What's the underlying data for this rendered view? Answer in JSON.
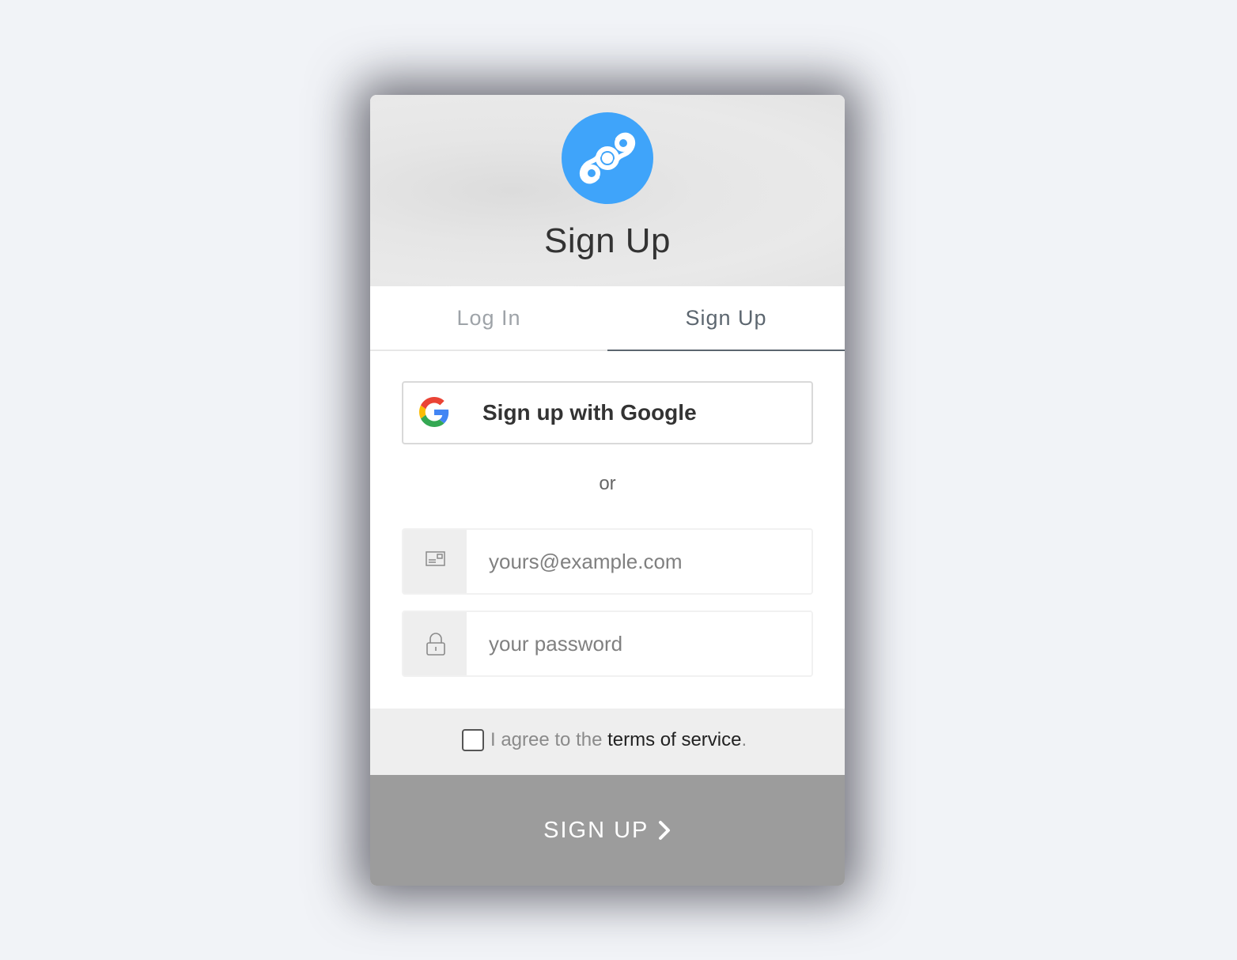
{
  "header": {
    "title": "Sign Up",
    "logo_icon": "helium-logo-icon",
    "logo_color": "#3fa4fa"
  },
  "tabs": [
    {
      "label": "Log In",
      "active": false
    },
    {
      "label": "Sign Up",
      "active": true
    }
  ],
  "google": {
    "label": "Sign up with Google",
    "icon": "google-icon"
  },
  "divider": {
    "text": "or"
  },
  "email": {
    "icon": "envelope-icon",
    "value": "",
    "placeholder": "yours@example.com"
  },
  "password": {
    "icon": "lock-icon",
    "value": "",
    "placeholder": "your password"
  },
  "terms": {
    "checked": false,
    "prefix": "I agree to the ",
    "link": "terms of service",
    "suffix": "."
  },
  "submit": {
    "label": "SIGN UP",
    "icon": "chevron-right-icon",
    "color": "#9c9c9c"
  }
}
